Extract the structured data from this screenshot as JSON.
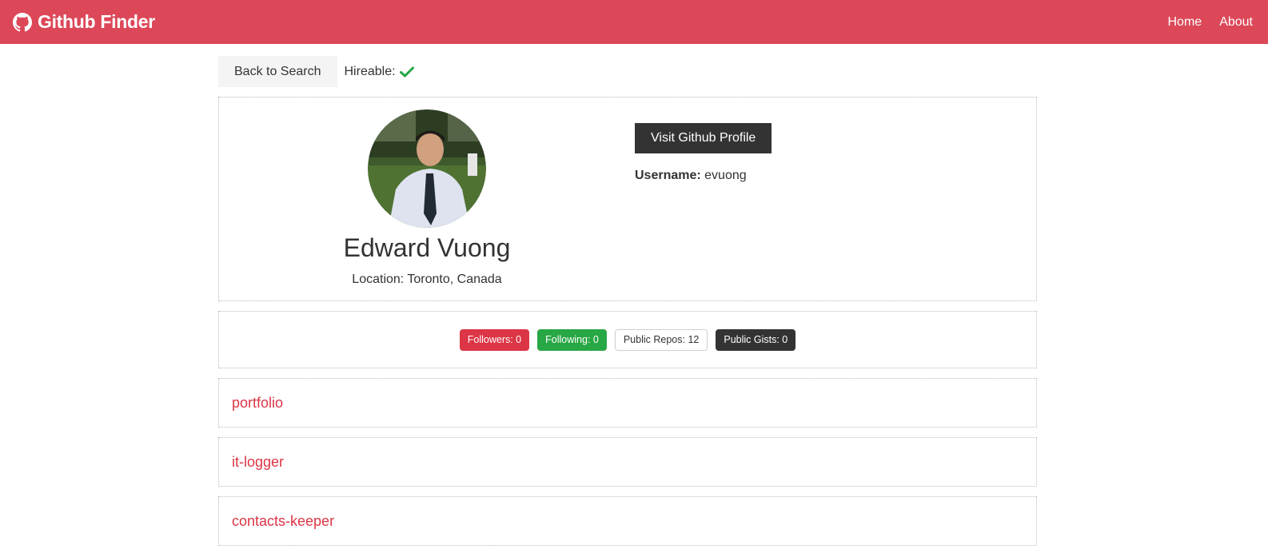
{
  "navbar": {
    "brand_icon": "github-icon",
    "title": "Github Finder",
    "links": [
      "Home",
      "About"
    ],
    "bg_color": "#dc4858"
  },
  "top_bar": {
    "back_label": "Back to Search",
    "hireable_label": "Hireable:",
    "hireable_icon": "check-icon",
    "hireable_color": "#28a745"
  },
  "profile": {
    "name": "Edward Vuong",
    "location": "Location: Toronto, Canada",
    "visit_label": "Visit Github Profile",
    "username_label": "Username:",
    "username_value": "evuong"
  },
  "stats": {
    "followers": "Followers: 0",
    "following": "Following: 0",
    "public_repos": "Public Repos: 12",
    "public_gists": "Public Gists: 0"
  },
  "repos": [
    {
      "name": "portfolio"
    },
    {
      "name": "it-logger"
    },
    {
      "name": "contacts-keeper"
    }
  ]
}
